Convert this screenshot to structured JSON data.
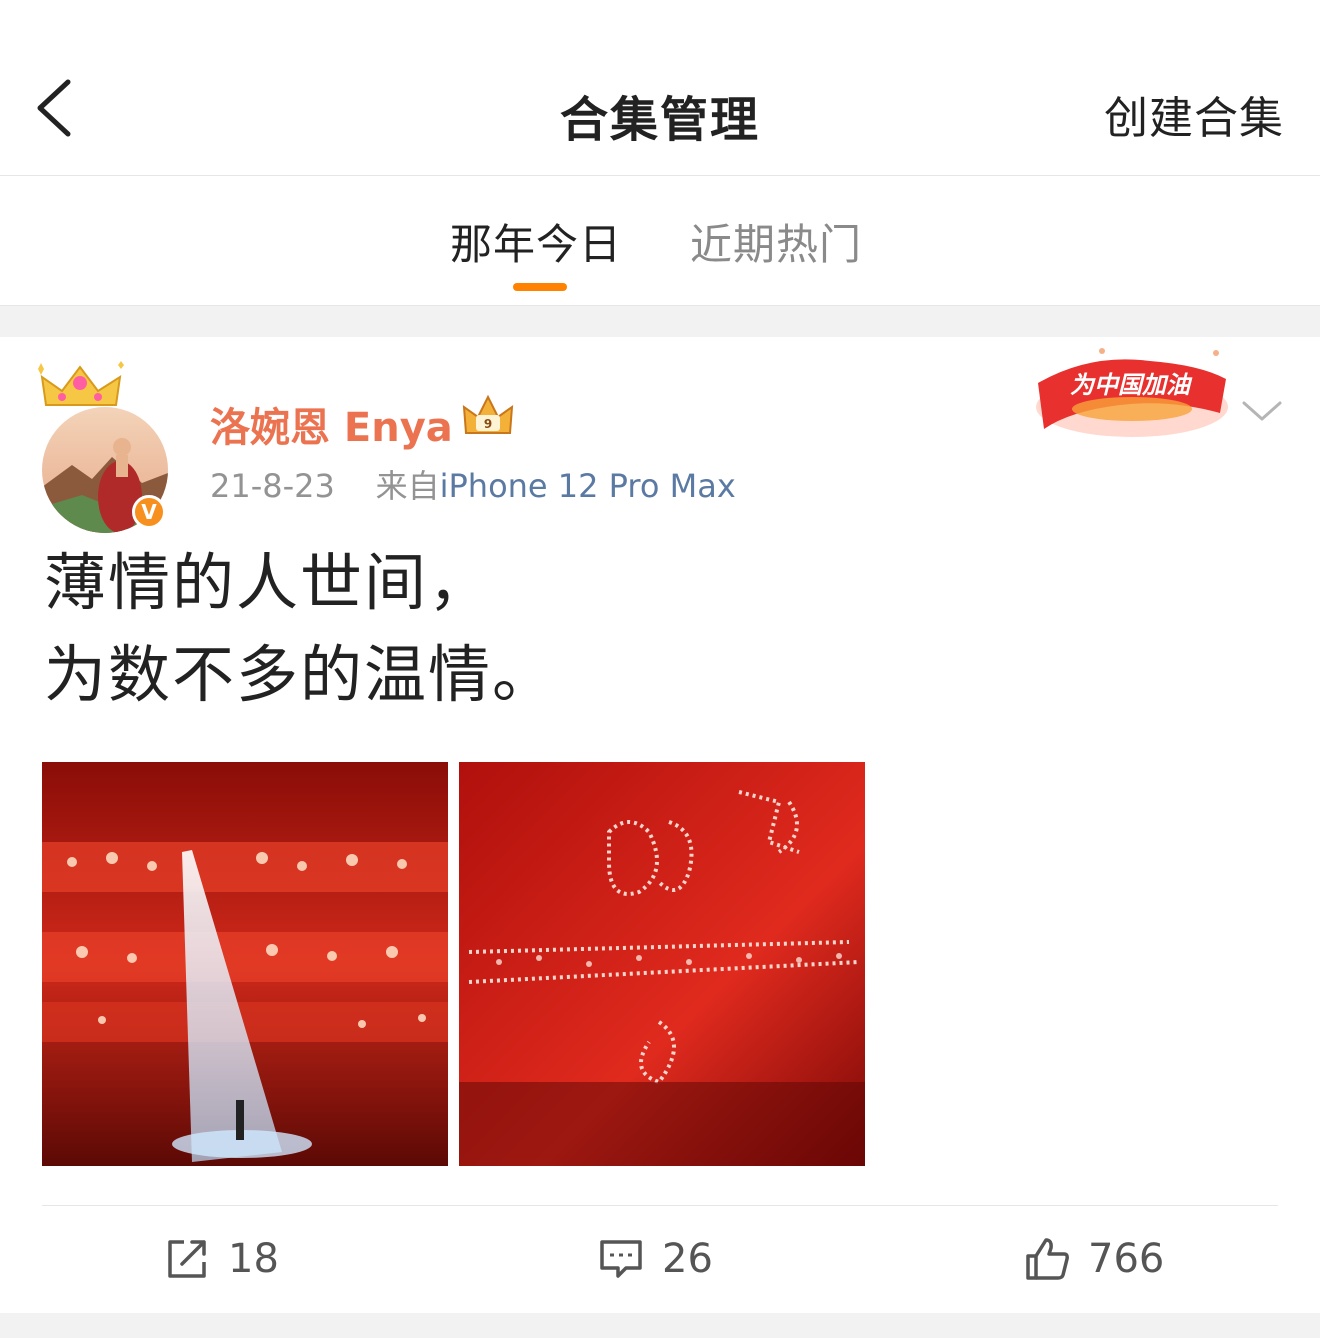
{
  "navbar": {
    "title": "合集管理",
    "create_label": "创建合集"
  },
  "tabs": [
    {
      "label": "那年今日",
      "active": true
    },
    {
      "label": "近期热门",
      "active": false
    }
  ],
  "post": {
    "username": "洛婉恩 Enya",
    "date": "21-8-23",
    "source_prefix": "来自",
    "device": "iPhone 12 Pro Max",
    "verified_mark": "V",
    "sticker_text": "为中国加油",
    "text_lines": [
      "薄情的人世间，",
      "为数不多的温情。"
    ],
    "images": [
      {
        "description_icon": "concert-photo"
      },
      {
        "description_icon": "banner-photo"
      }
    ],
    "actions": {
      "repost_count": "18",
      "comment_count": "26",
      "like_count": "766"
    }
  },
  "colors": {
    "accent": "#ff8200",
    "username": "#eb7350",
    "device_link": "#5b7aa3",
    "meta_gray": "#939393"
  }
}
